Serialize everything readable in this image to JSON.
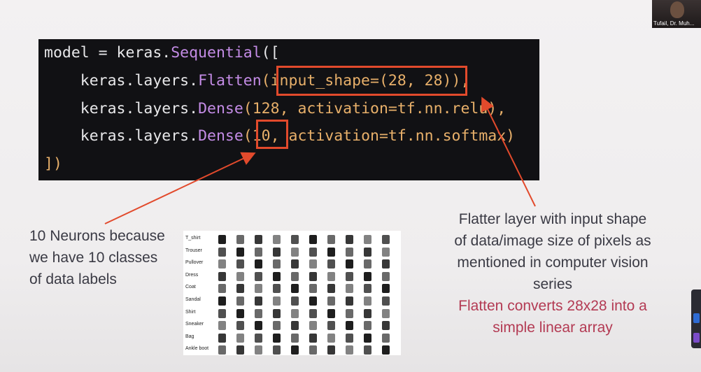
{
  "code": {
    "line1": {
      "a": "model = keras.",
      "b": "Sequential",
      "c": "(["
    },
    "line2": {
      "a": "    keras.layers.",
      "b": "Flatten",
      "c": "(input_shape=(28, 28)),"
    },
    "line3": {
      "a": "    keras.layers.",
      "b": "Dense",
      "c": "(128, activation=tf.nn.relu),"
    },
    "line4": {
      "a": "    keras.layers.",
      "b": "Dense",
      "c": "(10, activation=tf.nn.softmax)"
    },
    "line5": "])"
  },
  "notes": {
    "left": [
      "10 Neurons because",
      "we have 10 classes",
      "of data labels"
    ],
    "right": [
      "Flatter layer with input shape",
      "of data/image size of pixels as",
      "mentioned in computer vision",
      "series"
    ],
    "right_highlight": [
      "Flatten converts 28x28 into a",
      "simple linear array"
    ]
  },
  "dataset_labels": [
    "T_shirt",
    "Trouser",
    "Pullover",
    "Dress",
    "Coat",
    "Sandal",
    "Shirt",
    "Sneaker",
    "Bag",
    "Ankle boot"
  ],
  "webcam": {
    "name": "Tufail, Dr. Muh..."
  },
  "colors": {
    "highlight_box": "#e24a2c",
    "accent_pink": "#b33a53",
    "code_bg": "#111114"
  }
}
